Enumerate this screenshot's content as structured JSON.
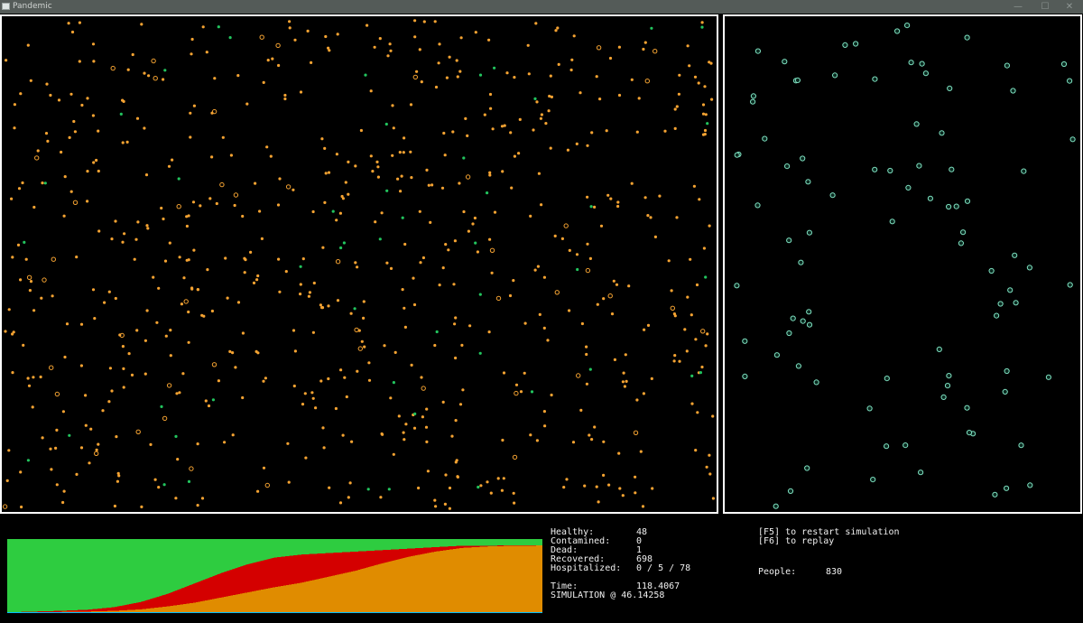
{
  "window": {
    "title": "Pandemic",
    "icon": "app-window-icon",
    "buttons": [
      {
        "name": "minimize",
        "glyph": "—"
      },
      {
        "name": "maximize",
        "glyph": "☐"
      },
      {
        "name": "close",
        "glyph": "✕"
      }
    ]
  },
  "colors": {
    "healthy": "#2ecc40",
    "contaminated": "#d40000",
    "recovered": "#e08c00",
    "dead": "#00bfff",
    "particle_recovered": "#f5a332",
    "particle_healthy": "#22c45e",
    "particle_hospital": "#7fe0c0",
    "border": "#ffffff"
  },
  "stats": {
    "healthy_label": "Healthy:",
    "healthy_value": "48",
    "contamined_label": "Contamined:",
    "contamined_value": "0",
    "dead_label": "Dead:",
    "dead_value": "1",
    "recovered_label": "Recovered:",
    "recovered_value": "698",
    "hospitalized_label": "Hospitalized:",
    "hospitalized_value": "0 / 5 / 78",
    "time_label": "Time:",
    "time_value": "118.4067",
    "simulation_text": "SIMULATION @ 46.14258"
  },
  "controls": {
    "restart_hint": "[F5] to restart simulation",
    "replay_hint": "[F6] to replay",
    "people_label": "People:",
    "people_value": "830"
  },
  "chart_data": {
    "type": "area",
    "stacking": "normalized",
    "x": {
      "from": 0,
      "to": 118.4067,
      "unit": "time"
    },
    "population": 830,
    "series": [
      {
        "key": "dead",
        "color": "#00bfff"
      },
      {
        "key": "recovered",
        "color": "#e08c00"
      },
      {
        "key": "contaminated",
        "color": "#d40000"
      },
      {
        "key": "healthy",
        "color": "#2ecc40"
      }
    ],
    "samples": [
      {
        "t": 0.0,
        "dead": 0.01,
        "recovered": 0.0,
        "contaminated": 0.0
      },
      {
        "t": 0.05,
        "dead": 0.01,
        "recovered": 0.0,
        "contaminated": 0.01
      },
      {
        "t": 0.1,
        "dead": 0.01,
        "recovered": 0.005,
        "contaminated": 0.015
      },
      {
        "t": 0.15,
        "dead": 0.01,
        "recovered": 0.01,
        "contaminated": 0.025
      },
      {
        "t": 0.2,
        "dead": 0.01,
        "recovered": 0.02,
        "contaminated": 0.05
      },
      {
        "t": 0.25,
        "dead": 0.01,
        "recovered": 0.04,
        "contaminated": 0.1
      },
      {
        "t": 0.3,
        "dead": 0.01,
        "recovered": 0.08,
        "contaminated": 0.17
      },
      {
        "t": 0.35,
        "dead": 0.01,
        "recovered": 0.13,
        "contaminated": 0.26
      },
      {
        "t": 0.4,
        "dead": 0.01,
        "recovered": 0.2,
        "contaminated": 0.33
      },
      {
        "t": 0.45,
        "dead": 0.01,
        "recovered": 0.27,
        "contaminated": 0.38
      },
      {
        "t": 0.5,
        "dead": 0.01,
        "recovered": 0.34,
        "contaminated": 0.4
      },
      {
        "t": 0.55,
        "dead": 0.01,
        "recovered": 0.4,
        "contaminated": 0.38
      },
      {
        "t": 0.6,
        "dead": 0.01,
        "recovered": 0.48,
        "contaminated": 0.32
      },
      {
        "t": 0.65,
        "dead": 0.01,
        "recovered": 0.56,
        "contaminated": 0.26
      },
      {
        "t": 0.7,
        "dead": 0.01,
        "recovered": 0.66,
        "contaminated": 0.18
      },
      {
        "t": 0.75,
        "dead": 0.01,
        "recovered": 0.75,
        "contaminated": 0.11
      },
      {
        "t": 0.8,
        "dead": 0.01,
        "recovered": 0.82,
        "contaminated": 0.06
      },
      {
        "t": 0.85,
        "dead": 0.01,
        "recovered": 0.87,
        "contaminated": 0.03
      },
      {
        "t": 0.9,
        "dead": 0.01,
        "recovered": 0.89,
        "contaminated": 0.01
      },
      {
        "t": 0.95,
        "dead": 0.01,
        "recovered": 0.9,
        "contaminated": 0.005
      },
      {
        "t": 1.0,
        "dead": 0.01,
        "recovered": 0.902,
        "contaminated": 0.0
      }
    ]
  }
}
